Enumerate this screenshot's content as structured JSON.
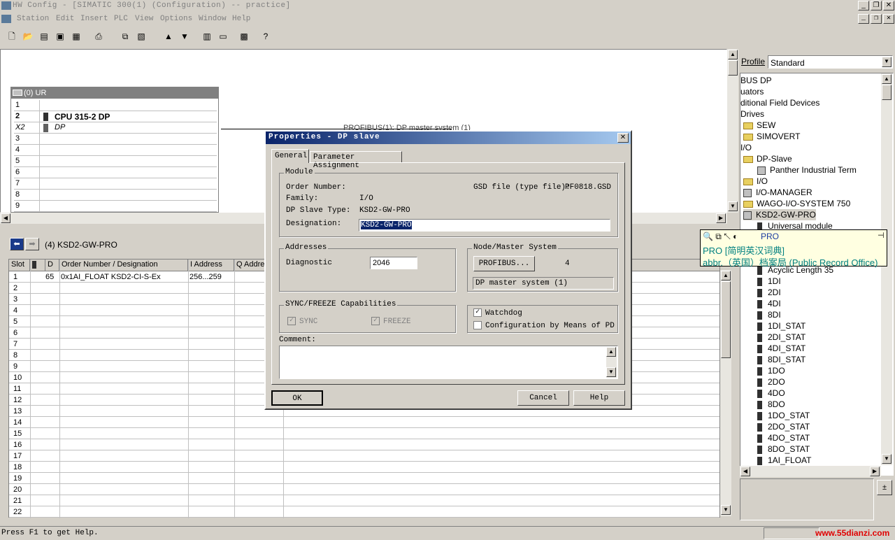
{
  "titlebar": {
    "title": "HW Config - [SIMATIC 300(1) (Configuration) -- practice]"
  },
  "menu": [
    "Station",
    "Edit",
    "Insert",
    "PLC",
    "View",
    "Options",
    "Window",
    "Help"
  ],
  "rack": {
    "title": "(0) UR",
    "rows": [
      {
        "slot": "1",
        "module": ""
      },
      {
        "slot": "2",
        "module": "CPU 315-2 DP"
      },
      {
        "slot": "X2",
        "module": "DP"
      },
      {
        "slot": "3",
        "module": ""
      },
      {
        "slot": "4",
        "module": ""
      },
      {
        "slot": "5",
        "module": ""
      },
      {
        "slot": "6",
        "module": ""
      },
      {
        "slot": "7",
        "module": ""
      },
      {
        "slot": "8",
        "module": ""
      },
      {
        "slot": "9",
        "module": ""
      }
    ],
    "profibus_label": "PROFIBUS(1): DP master system (1)"
  },
  "lower": {
    "device": "(4)   KSD2-GW-PRO",
    "headers": [
      "Slot",
      "",
      "D",
      "Order Number / Designation",
      "I Address",
      "Q Address"
    ],
    "first_row": {
      "slot": "1",
      "d": "65",
      "order": "0x1AI_FLOAT KSD2-CI-S-Ex",
      "iaddr": "256...259"
    },
    "empty_slots": [
      "2",
      "3",
      "4",
      "5",
      "6",
      "7",
      "8",
      "9",
      "10",
      "11",
      "12",
      "13",
      "14",
      "15",
      "16",
      "17",
      "18",
      "19",
      "20",
      "21",
      "22"
    ]
  },
  "catalog": {
    "profile_label": "Profile",
    "profile_value": "Standard",
    "items": [
      {
        "text": "BUS DP",
        "type": "text",
        "indent": 0
      },
      {
        "text": "uators",
        "type": "text",
        "indent": 0
      },
      {
        "text": "ditional Field Devices",
        "type": "text",
        "indent": 0
      },
      {
        "text": "Drives",
        "type": "text",
        "indent": 0
      },
      {
        "text": "SEW",
        "type": "folder",
        "indent": 1
      },
      {
        "text": "SIMOVERT",
        "type": "folder",
        "indent": 1
      },
      {
        "text": "I/O",
        "type": "text",
        "indent": 0
      },
      {
        "text": "DP-Slave",
        "type": "folder",
        "indent": 1
      },
      {
        "text": "Panther Industrial Term",
        "type": "device",
        "indent": 2
      },
      {
        "text": "I/O",
        "type": "folder",
        "indent": 1
      },
      {
        "text": "I/O-MANAGER",
        "type": "device",
        "indent": 1
      },
      {
        "text": "WAGO-I/O-SYSTEM 750",
        "type": "folder",
        "indent": 1
      },
      {
        "text": "KSD2-GW-PRO",
        "type": "device",
        "indent": 1
      },
      {
        "text": "Universal module",
        "type": "module",
        "indent": 2
      }
    ],
    "modules": [
      "Acyclic Length 35",
      "1DI",
      "2DI",
      "4DI",
      "8DI",
      "1DI_STAT",
      "2DI_STAT",
      "4DI_STAT",
      "8DI_STAT",
      "1DO",
      "2DO",
      "4DO",
      "8DO",
      "1DO_STAT",
      "2DO_STAT",
      "4DO_STAT",
      "8DO_STAT",
      "1AI_FLOAT"
    ]
  },
  "tooltip": {
    "word": "PRO",
    "line1": "PRO [简明英汉词典]",
    "line2": "abbr.（英国）档案局 (Public Record Office)"
  },
  "dialog": {
    "title": "Properties - DP slave",
    "tabs": [
      "General",
      "Parameter Assignment"
    ],
    "module_group": "Module",
    "order_number_label": "Order Number:",
    "order_number_value": "",
    "gsd_label": "GSD file (type file):",
    "gsd_value": "PF0818.GSD",
    "family_label": "Family:",
    "family_value": "I/O",
    "slave_type_label": "DP Slave Type:",
    "slave_type_value": "KSD2-GW-PRO",
    "designation_label": "Designation:",
    "designation_value": "KSD2-GW-PRO",
    "addresses_group": "Addresses",
    "diagnostic_label": "Diagnostic",
    "diagnostic_value": "2046",
    "node_group": "Node/Master System",
    "profibus_button": "PROFIBUS...",
    "node_number": "4",
    "master_system": "DP master system (1)",
    "sync_group": "SYNC/FREEZE Capabilities",
    "sync_label": "SYNC",
    "freeze_label": "FREEZE",
    "watchdog_label": "Watchdog",
    "config_pd_label": "Configuration by Means of PD",
    "comment_label": "Comment:",
    "ok": "OK",
    "cancel": "Cancel",
    "help": "Help"
  },
  "statusbar": {
    "text": "Press F1 to get Help.",
    "watermark": "www.55dianzi.com"
  }
}
